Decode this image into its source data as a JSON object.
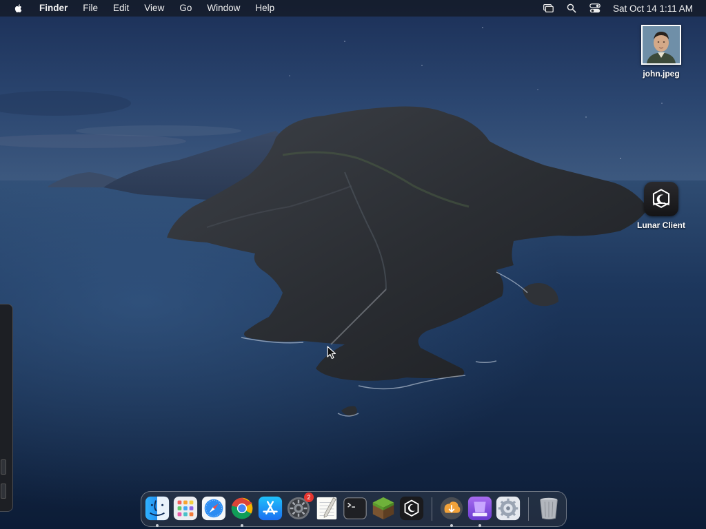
{
  "menubar": {
    "app_name": "Finder",
    "menus": [
      "File",
      "Edit",
      "View",
      "Go",
      "Window",
      "Help"
    ],
    "status_icons": [
      "screen-mirroring-icon",
      "spotlight-search-icon",
      "control-center-icon"
    ],
    "clock": "Sat Oct 14  1:11 AM"
  },
  "desktop": {
    "items": [
      {
        "label": "john.jpeg",
        "icon": "image-file-icon"
      },
      {
        "label": "Lunar Client",
        "icon": "lunar-client-icon"
      }
    ]
  },
  "dock": {
    "apps": [
      {
        "name": "finder",
        "running": true
      },
      {
        "name": "launchpad",
        "running": false
      },
      {
        "name": "safari",
        "running": false
      },
      {
        "name": "chrome",
        "running": true
      },
      {
        "name": "app-store",
        "running": false
      },
      {
        "name": "system-settings",
        "running": false,
        "badge": "2"
      },
      {
        "name": "textedit",
        "running": false
      },
      {
        "name": "terminal",
        "running": false
      },
      {
        "name": "minecraft",
        "running": false
      },
      {
        "name": "lunar-client",
        "running": false
      },
      {
        "name": "downloads",
        "running": true
      },
      {
        "name": "installer",
        "running": true
      },
      {
        "name": "system-preferences",
        "running": false
      },
      {
        "name": "trash",
        "running": false
      }
    ]
  },
  "colors": {
    "menubar_bg": "#14181f",
    "accent_red": "#e5352f",
    "sea": "#163258",
    "sky": "#1b2c55"
  }
}
